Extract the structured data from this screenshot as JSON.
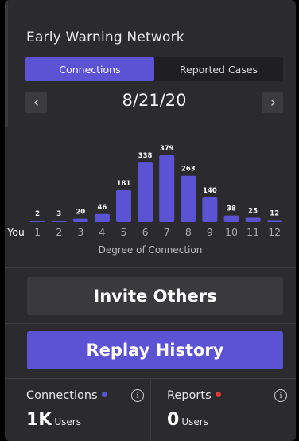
{
  "header": {
    "title": "Early Warning Network"
  },
  "tabs": [
    {
      "label": "Connections",
      "active": true
    },
    {
      "label": "Reported Cases",
      "active": false
    }
  ],
  "date_nav": {
    "date": "8/21/20",
    "prev_icon": "chevron-left",
    "next_icon": "chevron-right"
  },
  "chart_data": {
    "type": "bar",
    "categories": [
      "You",
      "1",
      "2",
      "3",
      "4",
      "5",
      "6",
      "7",
      "8",
      "9",
      "10",
      "11",
      "12"
    ],
    "values": [
      null,
      2,
      3,
      20,
      46,
      181,
      338,
      379,
      263,
      140,
      38,
      25,
      12
    ],
    "xlabel": "Degree of Connection",
    "ylabel": "",
    "ylim": [
      0,
      379
    ],
    "grid": false,
    "bar_color": "#5b52d4"
  },
  "buttons": {
    "invite": "Invite Others",
    "replay": "Replay History"
  },
  "stats": {
    "connections": {
      "label": "Connections",
      "value": "1K",
      "unit": "Users",
      "dot_color": "#5b52d4"
    },
    "reports": {
      "label": "Reports",
      "value": "0",
      "unit": "Users",
      "dot_color": "#e0393e"
    },
    "info_glyph": "i"
  },
  "colors": {
    "accent": "#5b52d4",
    "card": "#2b2b2d",
    "button_gray": "#3a3a3c"
  }
}
